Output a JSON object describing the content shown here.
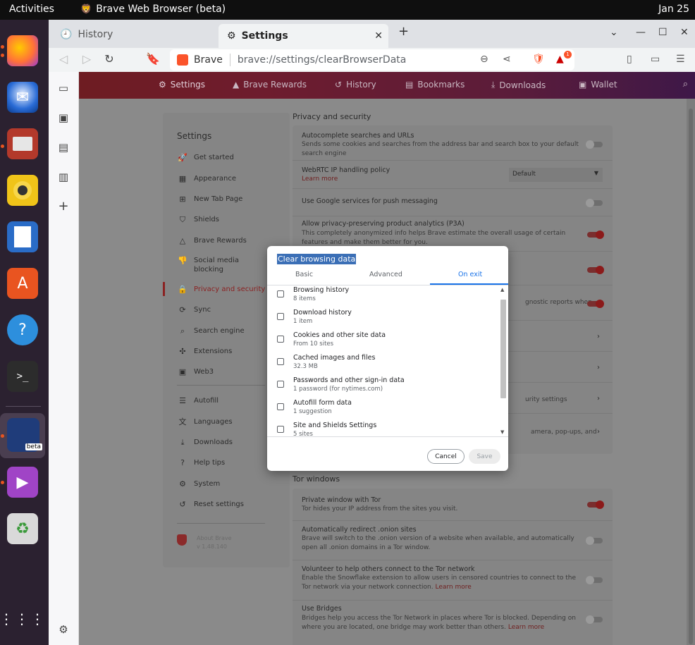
{
  "topbar": {
    "activities": "Activities",
    "app_title": "Brave Web Browser (beta)",
    "clock": "Jan 25"
  },
  "dock": {
    "items": [
      "firefox-icon",
      "thunderbird-icon",
      "files-icon",
      "rhythmbox-icon",
      "libreoffice-writer-icon",
      "app-center-icon",
      "help-icon",
      "terminal-icon",
      "brave-beta-icon",
      "media-player-icon",
      "trash-icon"
    ],
    "brave_badge": "beta"
  },
  "browser": {
    "tabs": [
      {
        "label": "History"
      },
      {
        "label": "Settings"
      }
    ],
    "omnibox": {
      "origin": "Brave",
      "url": "brave://settings/clearBrowserData"
    },
    "rewards_badge": "1"
  },
  "navbar": {
    "items": [
      "Settings",
      "Brave Rewards",
      "History",
      "Bookmarks",
      "Downloads",
      "Wallet"
    ]
  },
  "menu": {
    "title": "Settings",
    "items": [
      "Get started",
      "Appearance",
      "New Tab Page",
      "Shields",
      "Brave Rewards",
      "Social media blocking",
      "Privacy and security",
      "Sync",
      "Search engine",
      "Extensions",
      "Web3"
    ],
    "items2": [
      "Autofill",
      "Languages",
      "Downloads",
      "Help tips",
      "System",
      "Reset settings"
    ],
    "about_line1": "About Brave",
    "about_line2": "v 1.48.140"
  },
  "privacy": {
    "section_title": "Privacy and security",
    "rows": [
      {
        "title": "Autocomplete searches and URLs",
        "desc": "Sends some cookies and searches from the address bar and search box to your default search engine"
      },
      {
        "title": "WebRTC IP handling policy",
        "link": "Learn more",
        "dropdown": "Default"
      },
      {
        "title": "Use Google services for push messaging"
      },
      {
        "title": "Allow privacy-preserving product analytics (P3A)",
        "desc": "This completely anonymized info helps Brave estimate the overall usage of certain features and make them better for you."
      },
      {
        "desc_right": "gnostic reports when"
      },
      {
        "desc_right": "urity settings"
      },
      {
        "desc_right": "amera, pop-ups, and"
      }
    ]
  },
  "tor": {
    "section_title": "Tor windows",
    "rows": [
      {
        "title": "Private window with Tor",
        "desc": "Tor hides your IP address from the sites you visit."
      },
      {
        "title": "Automatically redirect .onion sites",
        "desc": "Brave will switch to the .onion version of a website when available, and automatically open all .onion domains in a Tor window."
      },
      {
        "title": "Volunteer to help others connect to the Tor network",
        "desc": "Enable the Snowflake extension to allow users in censored countries to connect to the Tor network via your network connection.",
        "link": "Learn more"
      },
      {
        "title": "Use Bridges",
        "desc": "Bridges help you access the Tor Network in places where Tor is blocked. Depending on where you are located, one bridge may work better than others.",
        "link": "Learn more"
      }
    ]
  },
  "dialog": {
    "title": "Clear browsing data",
    "tabs": [
      "Basic",
      "Advanced",
      "On exit"
    ],
    "items": [
      {
        "label": "Browsing history",
        "sub": "8 items"
      },
      {
        "label": "Download history",
        "sub": "1 item"
      },
      {
        "label": "Cookies and other site data",
        "sub": "From 10 sites"
      },
      {
        "label": "Cached images and files",
        "sub": "32.3 MB"
      },
      {
        "label": "Passwords and other sign-in data",
        "sub": "1 password (for nytimes.com)"
      },
      {
        "label": "Autofill form data",
        "sub": "1 suggestion"
      },
      {
        "label": "Site and Shields Settings",
        "sub": "5 sites"
      }
    ],
    "cancel": "Cancel",
    "save": "Save"
  },
  "colors": {
    "accent": "#1a73e8",
    "brave_orange": "#fb542b",
    "active_menu": "#8b2222"
  }
}
